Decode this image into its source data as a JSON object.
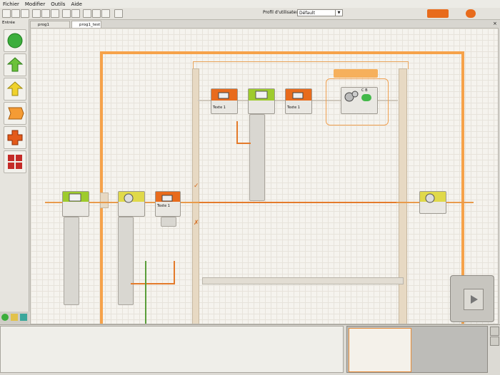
{
  "menu": {
    "file": "Fichier",
    "edit": "Modifier",
    "tools": "Outils",
    "help": "Aide"
  },
  "toolbar": {
    "profile_label": "Profil d'utilisateur :",
    "profile_value": "Défault"
  },
  "palette": {
    "title": "Entrée"
  },
  "tabs": [
    {
      "label": "prog1"
    },
    {
      "label": "prog1_test"
    }
  ],
  "blocks": {
    "text_label": "Texte 1",
    "cb_label": "C B"
  },
  "colors": {
    "accent": "#f6a24a",
    "orange_block": "#e86b1c",
    "green_block": "#9ecb2d"
  }
}
